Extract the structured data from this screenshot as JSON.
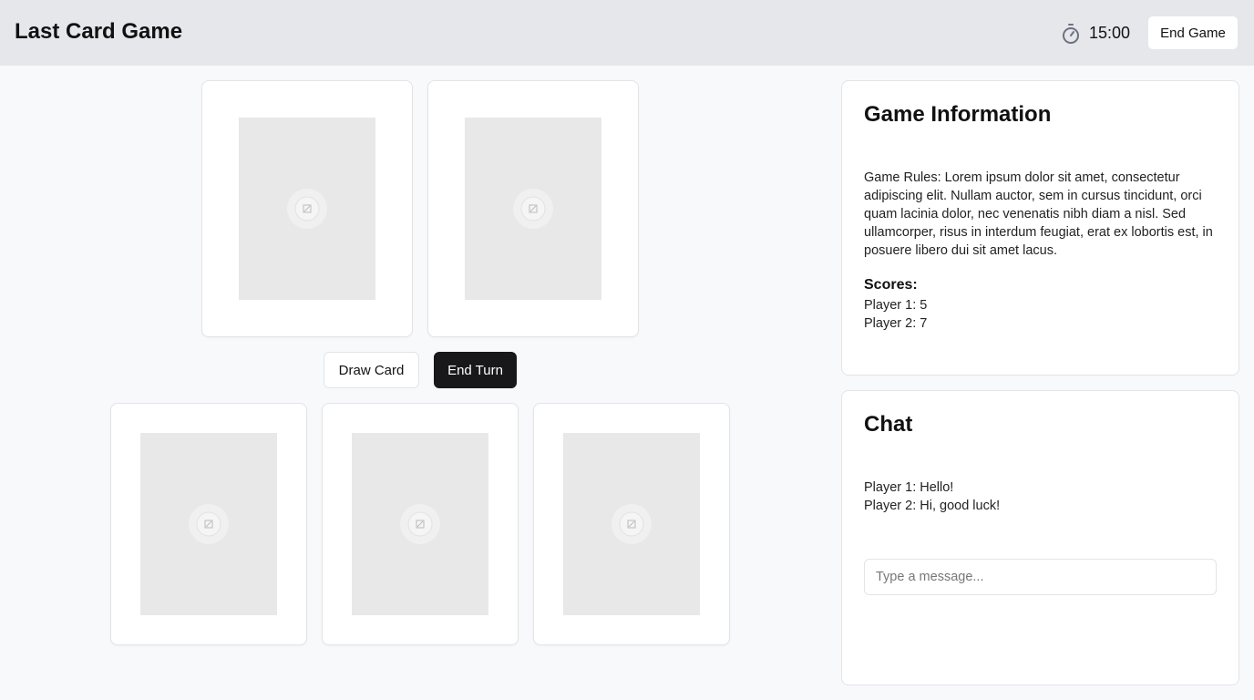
{
  "header": {
    "title": "Last Card Game",
    "timer": "15:00",
    "timer_icon": "stopwatch-icon",
    "end_game_label": "End Game"
  },
  "board": {
    "played_cards": [
      {
        "image": "image-placeholder-icon"
      },
      {
        "image": "image-placeholder-icon"
      }
    ],
    "actions": {
      "draw_card_label": "Draw Card",
      "end_turn_label": "End Turn"
    },
    "hand_cards": [
      {
        "image": "image-placeholder-icon"
      },
      {
        "image": "image-placeholder-icon"
      },
      {
        "image": "image-placeholder-icon"
      }
    ]
  },
  "game_info": {
    "title": "Game Information",
    "rules": "Game Rules: Lorem ipsum dolor sit amet, consectetur adipiscing elit. Nullam auctor, sem in cursus tincidunt, orci quam lacinia dolor, nec venenatis nibh diam a nisl. Sed ullamcorper, risus in interdum feugiat, erat ex lobortis est, in posuere libero dui sit amet lacus.",
    "scores_heading": "Scores:",
    "scores": [
      "Player 1: 5",
      "Player 2: 7"
    ]
  },
  "chat": {
    "title": "Chat",
    "messages": [
      "Player 1: Hello!",
      "Player 2: Hi, good luck!"
    ],
    "input_placeholder": "Type a message..."
  },
  "colors": {
    "header_bg": "#e5e7eb",
    "page_bg": "#f8f9fb",
    "primary_button": "#18181b",
    "card_placeholder": "#e8e8e8"
  }
}
